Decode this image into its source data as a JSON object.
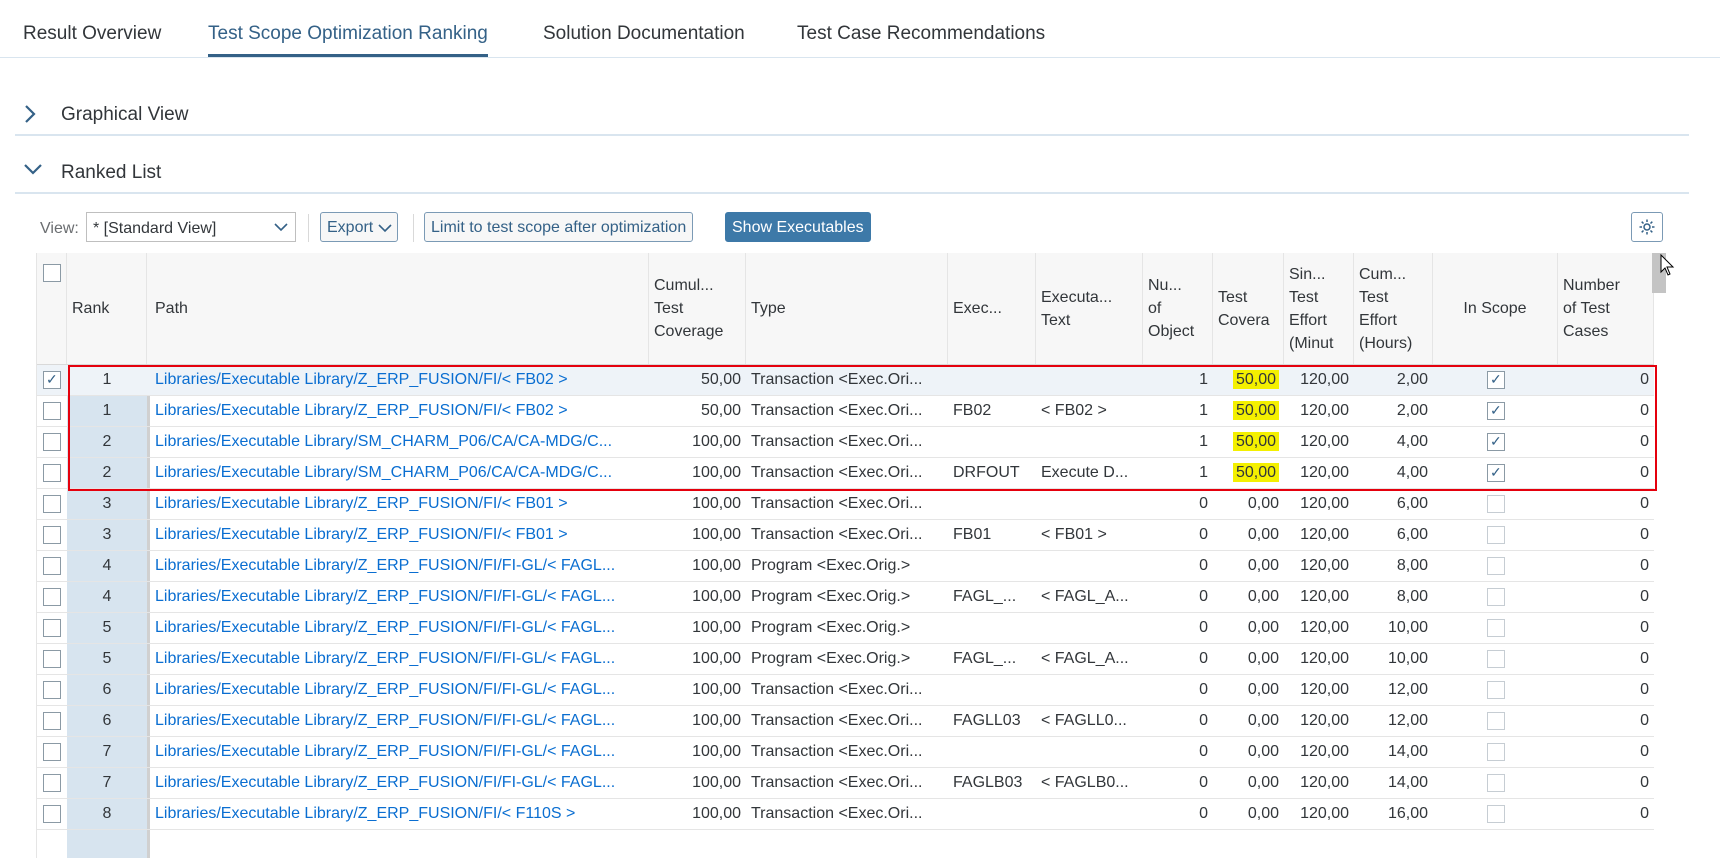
{
  "tabs": [
    {
      "label": "Result Overview",
      "active": false
    },
    {
      "label": "Test Scope Optimization Ranking",
      "active": true
    },
    {
      "label": "Solution Documentation",
      "active": false
    },
    {
      "label": "Test Case Recommendations",
      "active": false
    }
  ],
  "panels": {
    "graphical": {
      "title": "Graphical View",
      "expanded": false
    },
    "ranked": {
      "title": "Ranked List",
      "expanded": true
    }
  },
  "toolbar": {
    "view_label": "View:",
    "view_value": "* [Standard View]",
    "export_label": "Export",
    "limit_label": "Limit to test scope after optimization",
    "show_exec_label": "Show Executables"
  },
  "table": {
    "headers": {
      "rank": "Rank",
      "path": "Path",
      "cum_cov": "Cumul...\nTest\nCoverage",
      "type": "Type",
      "exec": "Exec...",
      "exec_text": "Executa...\nText",
      "num_obj": "Nu...\nof\nObject",
      "test_cov": "Test\nCovera",
      "single_eff": "Sin...\nTest\nEffort\n(Minut",
      "cum_eff": "Cum...\nTest\nEffort\n(Hours)",
      "in_scope": "In Scope",
      "num_tests": "Number\nof Test\nCases"
    },
    "highlight_color": "#f4f000",
    "rows": [
      {
        "checked": true,
        "rank": "1",
        "path": "Libraries/Executable Library/Z_ERP_FUSION/FI/< FB02 >",
        "cum_cov": "50,00",
        "type": "Transaction <Exec.Ori...",
        "exec": "",
        "exec_text": "",
        "num_obj": "1",
        "test_cov": "50,00",
        "hl": true,
        "single_eff": "120,00",
        "cum_eff": "2,00",
        "in_scope": true,
        "num_tests": "0"
      },
      {
        "checked": false,
        "rank": "1",
        "path": "Libraries/Executable Library/Z_ERP_FUSION/FI/< FB02 >",
        "cum_cov": "50,00",
        "type": "Transaction <Exec.Ori...",
        "exec": "FB02",
        "exec_text": "< FB02 >",
        "num_obj": "1",
        "test_cov": "50,00",
        "hl": true,
        "single_eff": "120,00",
        "cum_eff": "2,00",
        "in_scope": true,
        "num_tests": "0"
      },
      {
        "checked": false,
        "rank": "2",
        "path": "Libraries/Executable Library/SM_CHARM_P06/CA/CA-MDG/C...",
        "cum_cov": "100,00",
        "type": "Transaction <Exec.Ori...",
        "exec": "",
        "exec_text": "",
        "num_obj": "1",
        "test_cov": "50,00",
        "hl": true,
        "single_eff": "120,00",
        "cum_eff": "4,00",
        "in_scope": true,
        "num_tests": "0"
      },
      {
        "checked": false,
        "rank": "2",
        "path": "Libraries/Executable Library/SM_CHARM_P06/CA/CA-MDG/C...",
        "cum_cov": "100,00",
        "type": "Transaction <Exec.Ori...",
        "exec": "DRFOUT",
        "exec_text": "Execute D...",
        "num_obj": "1",
        "test_cov": "50,00",
        "hl": true,
        "single_eff": "120,00",
        "cum_eff": "4,00",
        "in_scope": true,
        "num_tests": "0"
      },
      {
        "checked": false,
        "rank": "3",
        "path": "Libraries/Executable Library/Z_ERP_FUSION/FI/< FB01 >",
        "cum_cov": "100,00",
        "type": "Transaction <Exec.Ori...",
        "exec": "",
        "exec_text": "",
        "num_obj": "0",
        "test_cov": "0,00",
        "hl": false,
        "single_eff": "120,00",
        "cum_eff": "6,00",
        "in_scope": false,
        "num_tests": "0"
      },
      {
        "checked": false,
        "rank": "3",
        "path": "Libraries/Executable Library/Z_ERP_FUSION/FI/< FB01 >",
        "cum_cov": "100,00",
        "type": "Transaction <Exec.Ori...",
        "exec": "FB01",
        "exec_text": "< FB01 >",
        "num_obj": "0",
        "test_cov": "0,00",
        "hl": false,
        "single_eff": "120,00",
        "cum_eff": "6,00",
        "in_scope": false,
        "num_tests": "0"
      },
      {
        "checked": false,
        "rank": "4",
        "path": "Libraries/Executable Library/Z_ERP_FUSION/FI/FI-GL/< FAGL...",
        "cum_cov": "100,00",
        "type": "Program <Exec.Orig.>",
        "exec": "",
        "exec_text": "",
        "num_obj": "0",
        "test_cov": "0,00",
        "hl": false,
        "single_eff": "120,00",
        "cum_eff": "8,00",
        "in_scope": false,
        "num_tests": "0"
      },
      {
        "checked": false,
        "rank": "4",
        "path": "Libraries/Executable Library/Z_ERP_FUSION/FI/FI-GL/< FAGL...",
        "cum_cov": "100,00",
        "type": "Program <Exec.Orig.>",
        "exec": "FAGL_...",
        "exec_text": "< FAGL_A...",
        "num_obj": "0",
        "test_cov": "0,00",
        "hl": false,
        "single_eff": "120,00",
        "cum_eff": "8,00",
        "in_scope": false,
        "num_tests": "0"
      },
      {
        "checked": false,
        "rank": "5",
        "path": "Libraries/Executable Library/Z_ERP_FUSION/FI/FI-GL/< FAGL...",
        "cum_cov": "100,00",
        "type": "Program <Exec.Orig.>",
        "exec": "",
        "exec_text": "",
        "num_obj": "0",
        "test_cov": "0,00",
        "hl": false,
        "single_eff": "120,00",
        "cum_eff": "10,00",
        "in_scope": false,
        "num_tests": "0"
      },
      {
        "checked": false,
        "rank": "5",
        "path": "Libraries/Executable Library/Z_ERP_FUSION/FI/FI-GL/< FAGL...",
        "cum_cov": "100,00",
        "type": "Program <Exec.Orig.>",
        "exec": "FAGL_...",
        "exec_text": "< FAGL_A...",
        "num_obj": "0",
        "test_cov": "0,00",
        "hl": false,
        "single_eff": "120,00",
        "cum_eff": "10,00",
        "in_scope": false,
        "num_tests": "0"
      },
      {
        "checked": false,
        "rank": "6",
        "path": "Libraries/Executable Library/Z_ERP_FUSION/FI/FI-GL/< FAGL...",
        "cum_cov": "100,00",
        "type": "Transaction <Exec.Ori...",
        "exec": "",
        "exec_text": "",
        "num_obj": "0",
        "test_cov": "0,00",
        "hl": false,
        "single_eff": "120,00",
        "cum_eff": "12,00",
        "in_scope": false,
        "num_tests": "0"
      },
      {
        "checked": false,
        "rank": "6",
        "path": "Libraries/Executable Library/Z_ERP_FUSION/FI/FI-GL/< FAGL...",
        "cum_cov": "100,00",
        "type": "Transaction <Exec.Ori...",
        "exec": "FAGLL03",
        "exec_text": "< FAGLL0...",
        "num_obj": "0",
        "test_cov": "0,00",
        "hl": false,
        "single_eff": "120,00",
        "cum_eff": "12,00",
        "in_scope": false,
        "num_tests": "0"
      },
      {
        "checked": false,
        "rank": "7",
        "path": "Libraries/Executable Library/Z_ERP_FUSION/FI/FI-GL/< FAGL...",
        "cum_cov": "100,00",
        "type": "Transaction <Exec.Ori...",
        "exec": "",
        "exec_text": "",
        "num_obj": "0",
        "test_cov": "0,00",
        "hl": false,
        "single_eff": "120,00",
        "cum_eff": "14,00",
        "in_scope": false,
        "num_tests": "0"
      },
      {
        "checked": false,
        "rank": "7",
        "path": "Libraries/Executable Library/Z_ERP_FUSION/FI/FI-GL/< FAGL...",
        "cum_cov": "100,00",
        "type": "Transaction <Exec.Ori...",
        "exec": "FAGLB03",
        "exec_text": "< FAGLB0...",
        "num_obj": "0",
        "test_cov": "0,00",
        "hl": false,
        "single_eff": "120,00",
        "cum_eff": "14,00",
        "in_scope": false,
        "num_tests": "0"
      },
      {
        "checked": false,
        "rank": "8",
        "path": "Libraries/Executable Library/Z_ERP_FUSION/FI/< F110S >",
        "cum_cov": "100,00",
        "type": "Transaction <Exec.Ori...",
        "exec": "",
        "exec_text": "",
        "num_obj": "0",
        "test_cov": "0,00",
        "hl": false,
        "single_eff": "120,00",
        "cum_eff": "16,00",
        "in_scope": false,
        "num_tests": "0"
      }
    ]
  }
}
